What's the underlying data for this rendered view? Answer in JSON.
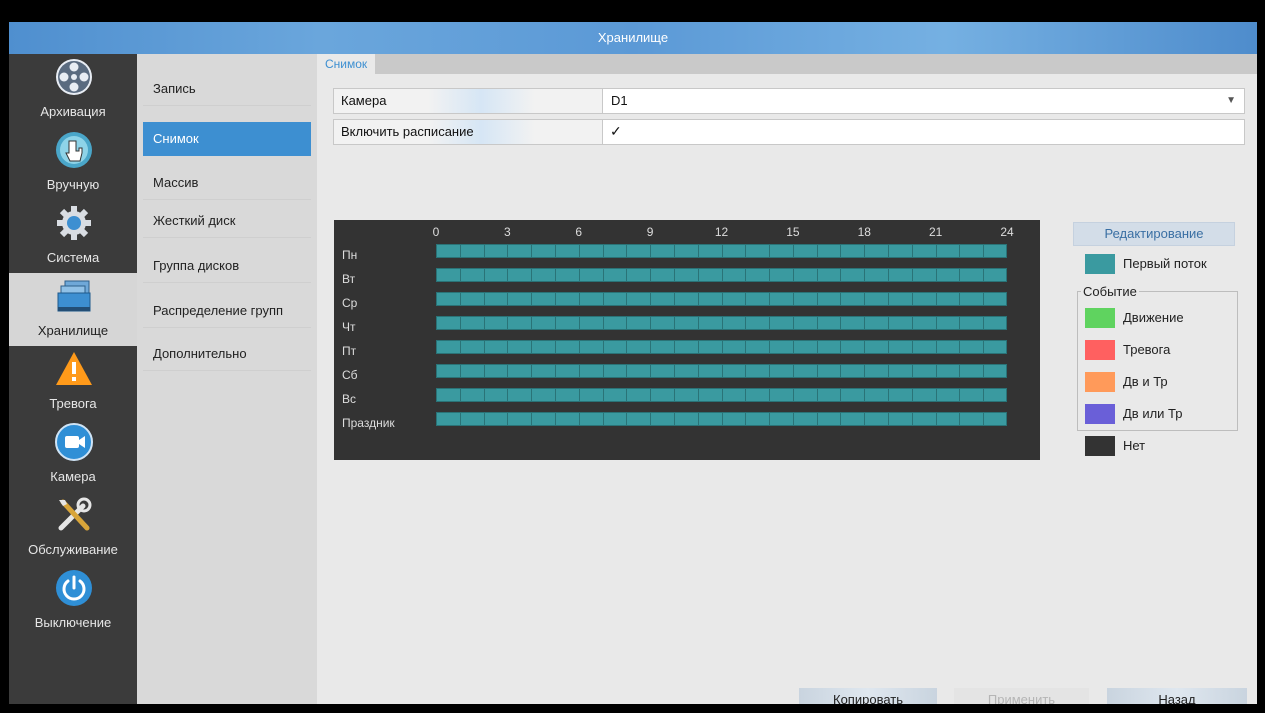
{
  "window": {
    "title": "Хранилище"
  },
  "nav": [
    {
      "label": "Архивация",
      "icon": "film-reel-icon"
    },
    {
      "label": "Вручную",
      "icon": "hand-pointer-icon"
    },
    {
      "label": "Система",
      "icon": "gear-icon"
    },
    {
      "label": "Хранилище",
      "icon": "storage-icon",
      "active": true
    },
    {
      "label": "Тревога",
      "icon": "warning-icon"
    },
    {
      "label": "Камера",
      "icon": "camera-icon"
    },
    {
      "label": "Обслуживание",
      "icon": "tools-icon"
    },
    {
      "label": "Выключение",
      "icon": "power-icon"
    }
  ],
  "submenu": [
    {
      "label": "Запись"
    },
    {
      "label": "Снимок",
      "active": true
    },
    {
      "label": "Массив"
    },
    {
      "label": "Жесткий диск"
    },
    {
      "label": "Группа дисков"
    },
    {
      "label": "Распределение групп"
    },
    {
      "label": "Дополнительно"
    }
  ],
  "tab": {
    "label": "Снимок"
  },
  "form": {
    "camera_label": "Камера",
    "camera_value": "D1",
    "schedule_label": "Включить расписание",
    "schedule_checked": true
  },
  "schedule": {
    "hours": [
      "0",
      "3",
      "6",
      "9",
      "12",
      "15",
      "18",
      "21",
      "24"
    ],
    "days": [
      "Пн",
      "Вт",
      "Ср",
      "Чт",
      "Пт",
      "Сб",
      "Вс",
      "Праздник"
    ]
  },
  "legend": {
    "edit_label": "Редактирование",
    "primary_stream": {
      "label": "Первый поток",
      "color": "#3a9aa0"
    },
    "event_title": "Событие",
    "events": [
      {
        "label": "Движение",
        "color": "#5fd35f"
      },
      {
        "label": "Тревога",
        "color": "#ff6060"
      },
      {
        "label": "Дв и Тр",
        "color": "#ff9a5a"
      },
      {
        "label": "Дв или Тр",
        "color": "#6a5fd8"
      }
    ],
    "none": {
      "label": "Нет",
      "color": "#333333"
    }
  },
  "buttons": {
    "copy": "Копировать",
    "apply": "Применить",
    "back": "Назад"
  }
}
